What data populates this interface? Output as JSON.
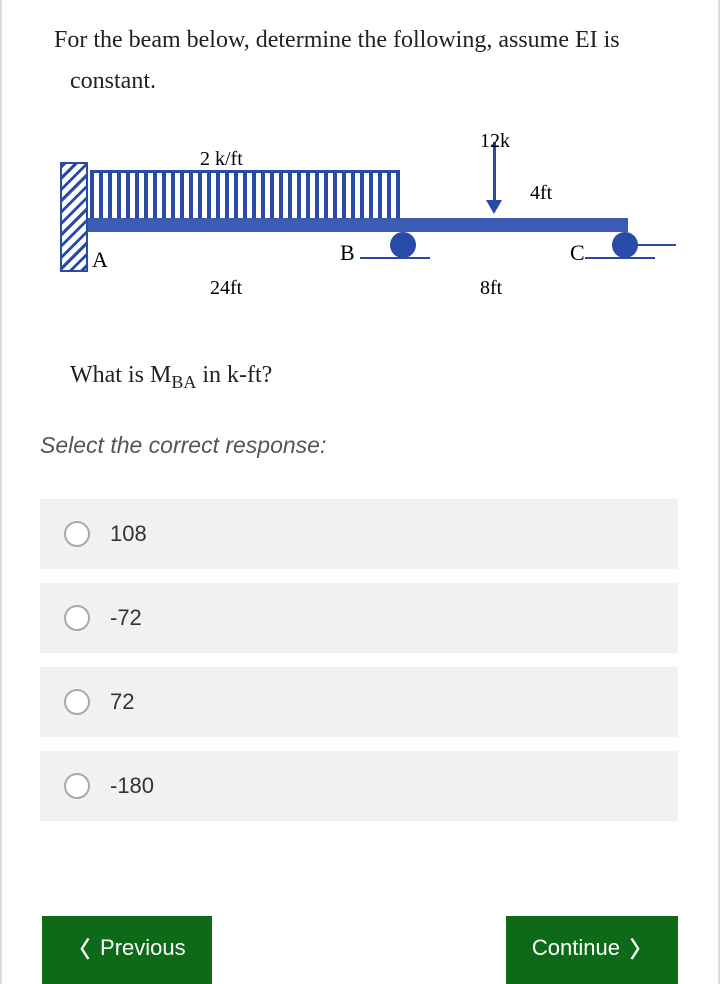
{
  "problem": {
    "statement": "For the beam below, determine the following, assume EI is constant.",
    "diagram": {
      "distributed_load": "2 k/ft",
      "point_load": "12k",
      "dim_4ft": "4ft",
      "dim_24ft": "24ft",
      "dim_8ft": "8ft",
      "point_A": "A",
      "point_B": "B",
      "point_C": "C"
    },
    "question_prefix": "What is M",
    "question_sub": "BA",
    "question_suffix": " in k-ft?",
    "instruction": "Select the correct response:",
    "options": [
      "108",
      "-72",
      "72",
      "-180"
    ]
  },
  "nav": {
    "previous": "Previous",
    "continue": "Continue"
  }
}
